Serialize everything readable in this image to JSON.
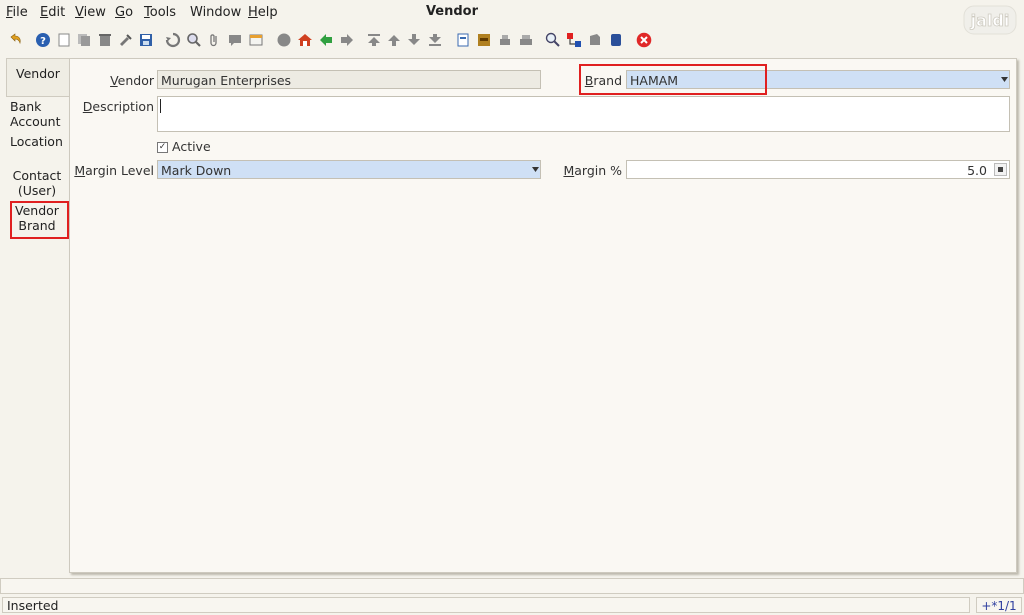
{
  "menu": {
    "items": [
      {
        "label": "File",
        "u": "F",
        "rest": "ile"
      },
      {
        "label": "Edit",
        "u": "E",
        "rest": "dit"
      },
      {
        "label": "View",
        "u": "V",
        "rest": "iew"
      },
      {
        "label": "Go",
        "u": "G",
        "rest": "o"
      },
      {
        "label": "Tools",
        "u": "T",
        "rest": "ools"
      },
      {
        "label": "Window",
        "u": "",
        "rest": "Window"
      },
      {
        "label": "Help",
        "u": "H",
        "rest": "elp"
      }
    ]
  },
  "window_title": "Vendor",
  "logo_text": "jaldi",
  "side_tabs": [
    {
      "line1": "Vendor",
      "line2": ""
    },
    {
      "line1": "Bank",
      "line2": "Account"
    },
    {
      "line1": "Location",
      "line2": ""
    },
    {
      "line1": "Contact",
      "line2": "(User)"
    },
    {
      "line1": "Vendor",
      "line2": "Brand"
    }
  ],
  "form": {
    "vendor_label_u": "V",
    "vendor_label_rest": "endor",
    "vendor_value": "Murugan Enterprises",
    "brand_label_u": "B",
    "brand_label_rest": "rand",
    "brand_value": "HAMAM",
    "description_label_u": "D",
    "description_label_rest": "escription",
    "description_value": "",
    "active_label": "Active",
    "active_checked": true,
    "margin_level_label_u": "M",
    "margin_level_label_rest": "argin Level",
    "margin_level_value": "Mark Down",
    "margin_pct_label_u": "M",
    "margin_pct_label_rest": "argin %",
    "margin_pct_value": "5.0"
  },
  "status": {
    "text": "Inserted",
    "record_nav": "+*1/1"
  },
  "colors": {
    "highlight": "#e02020",
    "field_blue": "#cfe0f5",
    "field_gray": "#edebe3"
  }
}
